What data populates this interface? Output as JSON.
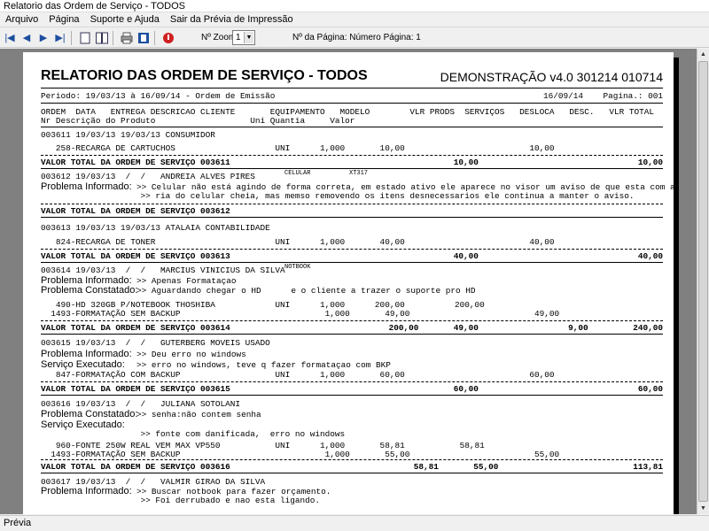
{
  "window": {
    "title": "Relatorio das Ordem de Serviço - TODOS"
  },
  "menu": [
    "Arquivo",
    "Página",
    "Suporte e Ajuda",
    "Sair da Prévia de Impressão"
  ],
  "toolbar": {
    "zoom_label": "Nº Zoom",
    "zoom_value": "1",
    "page_label": "Nº da Página: Número Página: 1"
  },
  "status": "Prévia",
  "report": {
    "title": "RELATORIO DAS ORDEM DE SERVIÇO - TODOS",
    "demo": "DEMONSTRAÇÃO v4.0 301214 010714",
    "period": "Periodo: 19/03/13 à 16/09/14 - Ordem de Emissão",
    "print_date": "16/09/14",
    "page": "Pagina.: 001",
    "header1": "ORDEM  DATA   ENTREGA DESCRICAO CLIENTE       EQUIPAMENTO   MODELO        VLR PRODS  SERVIÇOS   DESLOCA   DESC.   VLR TOTAL",
    "header2": "Nr Descrição do Produto                   Uni Quantia     Valor",
    "rows": [
      {
        "t": "003611 19/03/13 19/03/13 CONSUMIDOR"
      },
      {
        "t": "   258-RECARGA DE CARTUCHOS                    UNI      1,000       10,00                         10,00                                10,00"
      },
      {
        "t": "VALOR TOTAL DA ORDEM DE SERVIÇO 003611",
        "v": "10,00                                10,00"
      },
      {
        "t": "003612 19/03/13  /  /   ANDREIA ALVES PIRES",
        "eq": "CELULAR",
        "mod": "XT317"
      },
      {
        "lbl": "Problema Informado:",
        "t": ">> Celular não está agindo de forma correta, em estado ativo ele aparece no visor um aviso de que esta com a memo"
      },
      {
        "t": "                    >> ria do celular cheia, mas memso removendo os itens desnecessarios ele continua a manter o aviso."
      },
      {
        "t": "VALOR TOTAL DA ORDEM DE SERVIÇO 003612"
      },
      {
        "t": "003613 19/03/13 19/03/13 ATALAIA CONTABILIDADE"
      },
      {
        "t": "   824-RECARGA DE TONER                        UNI      1,000       40,00                         40,00                                40,00"
      },
      {
        "t": "VALOR TOTAL DA ORDEM DE SERVIÇO 003613",
        "v": "40,00                                40,00"
      },
      {
        "t": "003614 19/03/13  /  /   MARCIUS VINICIUS DA SILVA",
        "eq": "NOTBOOK"
      },
      {
        "lbl": "Problema Informado:",
        "t": ">> Apenas Formataçao"
      },
      {
        "lbl": "Problema Constatado:",
        "t": ">> Aguardando chegar o HD      e o cliente a trazer o suporte pro HD"
      },
      {
        "t": "   490-HD 320GB P/NOTEBOOK THOSHIBA            UNI      1,000      200,00          200,00                                         200,00"
      },
      {
        "t": "  1493-FORMATAÇÃO SEM BACKUP                             1,000       49,00                         49,00                                49,00"
      },
      {
        "t": "VALOR TOTAL DA ORDEM DE SERVIÇO 003614",
        "v": "200,00       49,00                  9,00         240,00"
      },
      {
        "t": "003615 19/03/13  /  /   GUTERBERG MOVEIS USADO"
      },
      {
        "lbl": "Problema Informado:",
        "t": ">> Deu erro no windows"
      },
      {
        "lbl": "Serviço Executado:",
        "t": ">> erro no windows, teve q fazer formataçao com BKP"
      },
      {
        "t": "   847-FORMATAÇÃO COM BACKUP                   UNI      1,000       60,00                         60,00                                60,00"
      },
      {
        "t": "VALOR TOTAL DA ORDEM DE SERVIÇO 003615",
        "v": "60,00                                60,00"
      },
      {
        "t": "003616 19/03/13  /  /   JULIANA SOTOLANI"
      },
      {
        "lbl": "Problema Constatado:",
        "t": ">> senha:não contem senha"
      },
      {
        "lbl": "Serviço Executado:",
        "t": ""
      },
      {
        "t": "                    >> fonte com danificada,  erro no windows"
      },
      {
        "t": "   960-FONTE 250W REAL VEM MAX VP550           UNI      1,000       58,81           58,81                                          58,81"
      },
      {
        "t": "  1493-FORMATAÇÃO SEM BACKUP                             1,000       55,00                         55,00                                55,00"
      },
      {
        "t": "VALOR TOTAL DA ORDEM DE SERVIÇO 003616",
        "v": "58,81       55,00                           113,81"
      },
      {
        "t": "003617 19/03/13  /  /   VALMIR GIRAO DA SILVA"
      },
      {
        "lbl": "Problema Informado:",
        "t": ">> Buscar notbook para fazer orçamento."
      },
      {
        "t": "                    >> Foi derrubado e nao esta ligando."
      }
    ]
  }
}
